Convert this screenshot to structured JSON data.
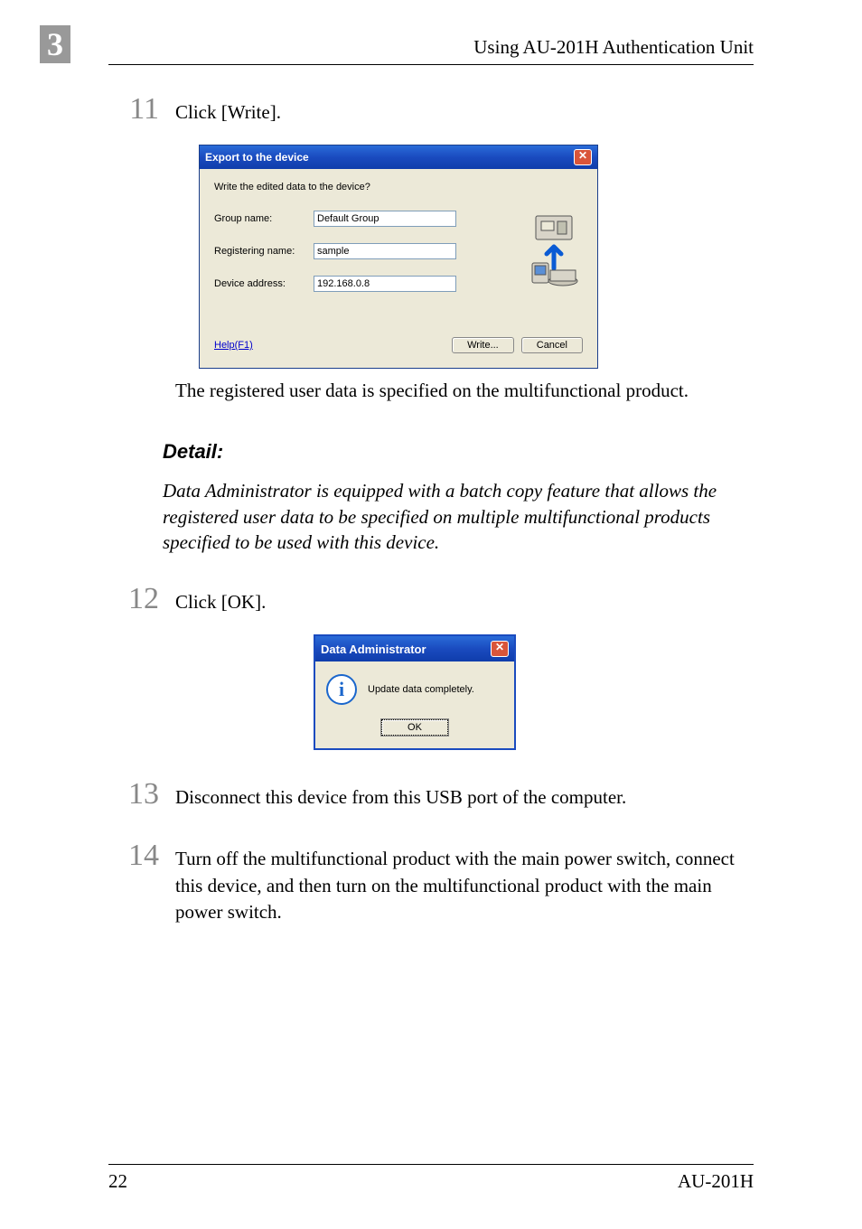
{
  "chapter": "3",
  "header": "Using AU-201H Authentication Unit",
  "steps": {
    "s11": {
      "num": "11",
      "text": "Click [Write]."
    },
    "s12": {
      "num": "12",
      "text": "Click [OK]."
    },
    "s13": {
      "num": "13",
      "text": "Disconnect this device from this USB port of the computer."
    },
    "s14": {
      "num": "14",
      "text": "Turn off the multifunctional product with the main power switch, connect this device, and then turn on the multifunctional product with the main power switch."
    }
  },
  "after11": "The registered user data is specified on the multifunctional product.",
  "detail_heading": "Detail:",
  "detail_body": "Data Administrator is equipped with a batch copy feature that allows the registered user data to be specified on multiple multifunctional products specified to be used with this device.",
  "export_dialog": {
    "title": "Export to the device",
    "prompt": "Write the edited data to the device?",
    "group_label": "Group name:",
    "group_value": "Default Group",
    "reg_label": "Registering name:",
    "reg_value": "sample",
    "addr_label": "Device address:",
    "addr_value": "192.168.0.8",
    "help": "Help(F1)",
    "write": "Write...",
    "cancel": "Cancel"
  },
  "da_dialog": {
    "title": "Data Administrator",
    "msg": "Update data completely.",
    "ok": "OK"
  },
  "footer": {
    "page": "22",
    "product": "AU-201H"
  }
}
